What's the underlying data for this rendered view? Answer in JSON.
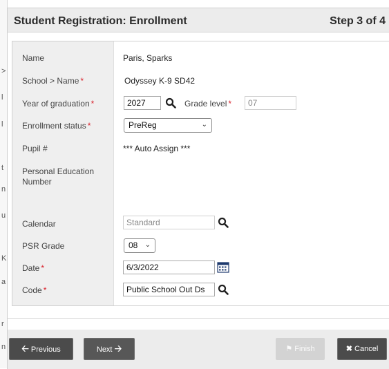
{
  "background_marks": [
    ">",
    "l",
    "l",
    "t",
    "n",
    "u",
    "K",
    "a",
    "r",
    "n"
  ],
  "header": {
    "title": "Student Registration: Enrollment",
    "step": "Step 3 of 4"
  },
  "form": {
    "name": {
      "label": "Name",
      "value": "Paris, Sparks"
    },
    "school": {
      "label": "School > Name",
      "value": "Odyssey K-9 SD42"
    },
    "year_of_graduation": {
      "label": "Year of graduation",
      "value": "2027"
    },
    "grade_level": {
      "label": "Grade level",
      "value": "07"
    },
    "enrollment_status": {
      "label": "Enrollment status",
      "value": "PreReg"
    },
    "pupil_number": {
      "label": "Pupil #",
      "value": "*** Auto Assign ***"
    },
    "pen": {
      "label": "Personal Education Number",
      "value": ""
    },
    "calendar": {
      "label": "Calendar",
      "placeholder": "Standard"
    },
    "psr_grade": {
      "label": "PSR Grade",
      "value": "08"
    },
    "date": {
      "label": "Date",
      "value": "6/3/2022"
    },
    "code": {
      "label": "Code",
      "value": "Public School Out Ds"
    }
  },
  "buttons": {
    "previous": "Previous",
    "next": "Next",
    "finish": "Finish",
    "cancel": "Cancel"
  },
  "colors": {
    "required": "#d9202a",
    "header_bg": "#ececec",
    "label_col_bg": "#efefef",
    "button_dark": "#4b4b4b"
  }
}
